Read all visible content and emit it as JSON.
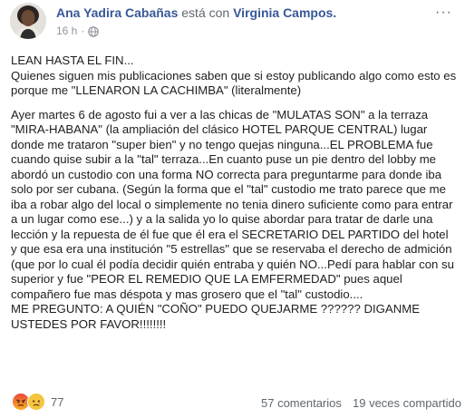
{
  "post": {
    "author": "Ana Yadira Cabañas",
    "with_text": "está con",
    "tagged": "Virginia Campos.",
    "time": "16 h",
    "dot": "·",
    "more": "···"
  },
  "content": {
    "lines": [
      "LEAN HASTA EL FIN...",
      "Quienes siguen mis publicaciones saben que si estoy publicando algo como esto es porque me \"LLENARON LA CACHIMBA\" (literalmente)",
      "",
      "Ayer martes 6 de agosto fui a ver a las chicas de \"MULATAS SON\" a la terraza \"MIRA-HABANA\" (la ampliación del clásico HOTEL PARQUE CENTRAL) lugar donde me trataron \"super bien\" y no tengo quejas ninguna...EL PROBLEMA fue cuando quise subir a la \"tal\" terraza...En cuanto puse un pie dentro del lobby me abordó un custodio con una forma NO correcta para preguntarme para donde iba solo por ser cubana. (Según la forma que el \"tal\" custodio me trato parece que me iba a robar algo del local o simplemente no tenia dinero suficiente como para entrar a un lugar como ese...) y a la salida yo lo quise abordar para tratar de darle una lección y la repuesta de él fue que él era el SECRETARIO DEL PARTIDO del hotel y que esa era una institución \"5 estrellas\" que se reservaba el derecho de admición (que por lo cual él podía decidir quién entraba y quién NO...Pedí para hablar con su superior y fue \"PEOR EL REMEDIO QUE LA EMFERMEDAD\" pues aquel compañero fue mas déspota y mas grosero que el \"tal\" custodio....",
      "ME PREGUNTO: A QUIÉN \"COÑO\" PUEDO QUEJARME ?????? DIGANME USTEDES POR FAVOR!!!!!!!!"
    ]
  },
  "footer": {
    "reaction_count": "77",
    "comments": "57 comentarios",
    "shares": "19 veces compartido"
  },
  "colors": {
    "link": "#385898",
    "muted": "#606770",
    "angry": "#f5733b",
    "sad": "#f7c440"
  },
  "icons": [
    "globe-icon",
    "angry-reaction-icon",
    "sad-reaction-icon",
    "more-options-icon"
  ]
}
